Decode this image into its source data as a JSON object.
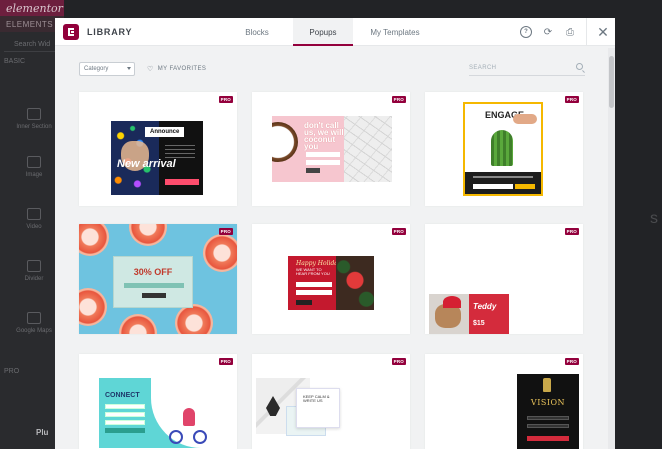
{
  "editor": {
    "logo": "elementor",
    "panel_tab": "ELEMENTS",
    "search_placeholder": "Search Wid",
    "section": "BASIC",
    "widgets": [
      "Inner Section",
      "Image",
      "Video",
      "Divider",
      "Google Maps"
    ],
    "pro_section": "PRO",
    "bottom_item": "Plu"
  },
  "modal": {
    "title": "LIBRARY",
    "tabs": [
      {
        "label": "Blocks",
        "active": false
      },
      {
        "label": "Popups",
        "active": true
      },
      {
        "label": "My Templates",
        "active": false
      }
    ],
    "tools": {
      "info": "?",
      "sync": "⟳",
      "save": "⎙",
      "close": "✕"
    },
    "filters": {
      "category_placeholder": "Category",
      "favorites_label": "MY FAVORITES",
      "search_placeholder": "SEARCH"
    },
    "badge": "PRO",
    "accent_color": "#93003c"
  },
  "templates": [
    {
      "id": "announce",
      "texts": {
        "tag": "Announce",
        "headline": "New arrival"
      }
    },
    {
      "id": "coconut",
      "texts": {
        "headline": "don't call us, we will coconut you"
      }
    },
    {
      "id": "engage",
      "texts": {
        "headline": "ENGAGE"
      }
    },
    {
      "id": "grapefruit",
      "texts": {
        "headline": "30% OFF"
      }
    },
    {
      "id": "holidays",
      "texts": {
        "headline": "Happy Holidays",
        "sub": "WE WANT TO HEAR FROM YOU"
      }
    },
    {
      "id": "teddy",
      "texts": {
        "headline": "Teddy",
        "price": "$15"
      }
    },
    {
      "id": "connect",
      "texts": {
        "headline": "CONNECT"
      }
    },
    {
      "id": "keep-calm",
      "texts": {
        "headline": "KEEP CALM & WRITE US"
      }
    },
    {
      "id": "vision",
      "texts": {
        "headline": "VISION"
      }
    }
  ]
}
